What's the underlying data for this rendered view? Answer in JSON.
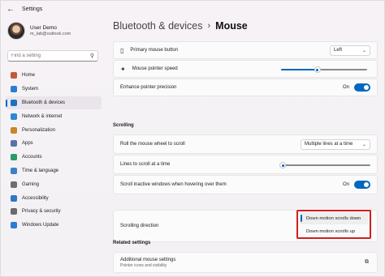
{
  "window": {
    "title": "Settings"
  },
  "profile": {
    "name": "User Demo",
    "email": "m_lab@outlook.com"
  },
  "search": {
    "placeholder": "Find a setting"
  },
  "nav": [
    {
      "label": "Home",
      "icon": "home-icon",
      "color": "#c45a3b",
      "active": false
    },
    {
      "label": "System",
      "icon": "system-icon",
      "color": "#2b7cd3",
      "active": false
    },
    {
      "label": "Bluetooth & devices",
      "icon": "bluetooth-icon",
      "color": "#1f6fbf",
      "active": true
    },
    {
      "label": "Network & internet",
      "icon": "network-icon",
      "color": "#2a8ad8",
      "active": false
    },
    {
      "label": "Personalization",
      "icon": "brush-icon",
      "color": "#c7862b",
      "active": false
    },
    {
      "label": "Apps",
      "icon": "apps-icon",
      "color": "#5a6fb0",
      "active": false
    },
    {
      "label": "Accounts",
      "icon": "accounts-icon",
      "color": "#2c9a6a",
      "active": false
    },
    {
      "label": "Time & language",
      "icon": "time-icon",
      "color": "#3a83c9",
      "active": false
    },
    {
      "label": "Gaming",
      "icon": "gaming-icon",
      "color": "#6e6e6e",
      "active": false
    },
    {
      "label": "Accessibility",
      "icon": "accessibility-icon",
      "color": "#2f78c4",
      "active": false
    },
    {
      "label": "Privacy & security",
      "icon": "shield-icon",
      "color": "#6b6b6b",
      "active": false
    },
    {
      "label": "Windows Update",
      "icon": "update-icon",
      "color": "#2b7cd3",
      "active": false
    }
  ],
  "breadcrumb": {
    "parent": "Bluetooth & devices",
    "separator": "›",
    "current": "Mouse"
  },
  "settings": {
    "primary_button": {
      "label": "Primary mouse button",
      "value": "Left"
    },
    "pointer_speed": {
      "label": "Mouse pointer speed",
      "level": 0.42
    },
    "enhance_precision": {
      "label": "Enhance pointer precision",
      "state": "On"
    },
    "scrolling_title": "Scrolling",
    "roll_wheel": {
      "label": "Roll the mouse wheel to scroll",
      "value": "Multiple lines at a time"
    },
    "lines_to_scroll": {
      "label": "Lines to scroll at a time",
      "level": 0.02
    },
    "scroll_inactive": {
      "label": "Scroll inactive windows when hovering over them",
      "state": "On"
    },
    "scroll_direction": {
      "label": "Scrolling direction",
      "options": [
        "Down motion scrolls down",
        "Down motion scrolls up"
      ],
      "selected": "Down motion scrolls down"
    },
    "related_title": "Related settings",
    "additional": {
      "label": "Additional mouse settings",
      "sub": "Pointer icons and visibility"
    }
  },
  "colors": {
    "accent": "#0067c0",
    "highlight_border": "#d11f1f"
  }
}
